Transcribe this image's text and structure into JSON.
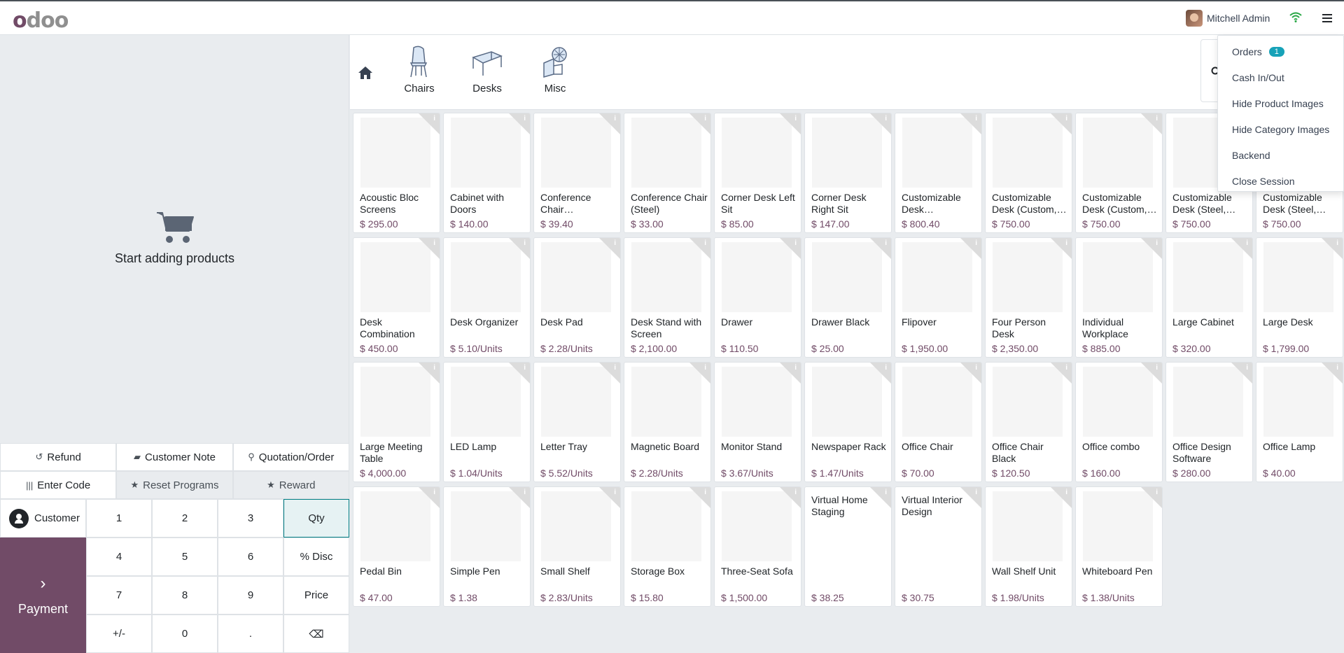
{
  "brand": "odoo",
  "user": {
    "name": "Mitchell Admin"
  },
  "empty_cart": "Start adding products",
  "controls": {
    "refund": "Refund",
    "customer_note": "Customer Note",
    "quotation": "Quotation/Order",
    "enter_code": "Enter Code",
    "reset_programs": "Reset Programs",
    "reward": "Reward"
  },
  "numpad": {
    "customer": "Customer",
    "payment": "Payment",
    "keys": [
      "1",
      "2",
      "3",
      "Qty",
      "4",
      "5",
      "6",
      "% Disc",
      "7",
      "8",
      "9",
      "Price",
      "+/-",
      "0",
      ".",
      "⌫"
    ]
  },
  "categories": [
    {
      "label": "Chairs",
      "icon": "chair-icon"
    },
    {
      "label": "Desks",
      "icon": "desk-icon"
    },
    {
      "label": "Misc",
      "icon": "misc-icon"
    }
  ],
  "menu": {
    "orders": "Orders",
    "orders_badge": "1",
    "cash": "Cash In/Out",
    "hide_products": "Hide Product Images",
    "hide_categories": "Hide Category Images",
    "backend": "Backend",
    "close": "Close Session"
  },
  "products": [
    {
      "name": "Acoustic Bloc Screens",
      "price": "$ 295.00"
    },
    {
      "name": "Cabinet with Doors",
      "price": "$ 140.00"
    },
    {
      "name": "Conference Chair…",
      "price": "$ 39.40"
    },
    {
      "name": "Conference Chair (Steel)",
      "price": "$ 33.00"
    },
    {
      "name": "Corner Desk Left Sit",
      "price": "$ 85.00"
    },
    {
      "name": "Corner Desk Right Sit",
      "price": "$ 147.00"
    },
    {
      "name": "Customizable Desk…",
      "price": "$ 800.40"
    },
    {
      "name": "Customizable Desk (Custom,…",
      "price": "$ 750.00"
    },
    {
      "name": "Customizable Desk (Custom,…",
      "price": "$ 750.00"
    },
    {
      "name": "Customizable Desk (Steel,…",
      "price": "$ 750.00"
    },
    {
      "name": "Customizable Desk (Steel,…",
      "price": "$ 750.00"
    },
    {
      "name": "Desk Combination",
      "price": "$ 450.00"
    },
    {
      "name": "Desk Organizer",
      "price": "$ 5.10/Units"
    },
    {
      "name": "Desk Pad",
      "price": "$ 2.28/Units"
    },
    {
      "name": "Desk Stand with Screen",
      "price": "$ 2,100.00"
    },
    {
      "name": "Drawer",
      "price": "$ 110.50"
    },
    {
      "name": "Drawer Black",
      "price": "$ 25.00"
    },
    {
      "name": "Flipover",
      "price": "$ 1,950.00"
    },
    {
      "name": "Four Person Desk",
      "price": "$ 2,350.00"
    },
    {
      "name": "Individual Workplace",
      "price": "$ 885.00"
    },
    {
      "name": "Large Cabinet",
      "price": "$ 320.00"
    },
    {
      "name": "Large Desk",
      "price": "$ 1,799.00"
    },
    {
      "name": "Large Meeting Table",
      "price": "$ 4,000.00"
    },
    {
      "name": "LED Lamp",
      "price": "$ 1.04/Units"
    },
    {
      "name": "Letter Tray",
      "price": "$ 5.52/Units"
    },
    {
      "name": "Magnetic Board",
      "price": "$ 2.28/Units"
    },
    {
      "name": "Monitor Stand",
      "price": "$ 3.67/Units"
    },
    {
      "name": "Newspaper Rack",
      "price": "$ 1.47/Units"
    },
    {
      "name": "Office Chair",
      "price": "$ 70.00"
    },
    {
      "name": "Office Chair Black",
      "price": "$ 120.50"
    },
    {
      "name": "Office combo",
      "price": "$ 160.00"
    },
    {
      "name": "Office Design Software",
      "price": "$ 280.00"
    },
    {
      "name": "Office Lamp",
      "price": "$ 40.00"
    },
    {
      "name": "Pedal Bin",
      "price": "$ 47.00"
    },
    {
      "name": "Simple Pen",
      "price": "$ 1.38"
    },
    {
      "name": "Small Shelf",
      "price": "$ 2.83/Units"
    },
    {
      "name": "Storage Box",
      "price": "$ 15.80"
    },
    {
      "name": "Three-Seat Sofa",
      "price": "$ 1,500.00"
    },
    {
      "name": "Virtual Home Staging",
      "price": "$ 38.25",
      "noimg": true
    },
    {
      "name": "Virtual Interior Design",
      "price": "$ 30.75",
      "noimg": true
    },
    {
      "name": "Wall Shelf Unit",
      "price": "$ 1.98/Units"
    },
    {
      "name": "Whiteboard Pen",
      "price": "$ 1.38/Units"
    }
  ],
  "colors": {
    "brand": "#714b67",
    "accent": "#017e84",
    "badge": "#17a2b8"
  }
}
